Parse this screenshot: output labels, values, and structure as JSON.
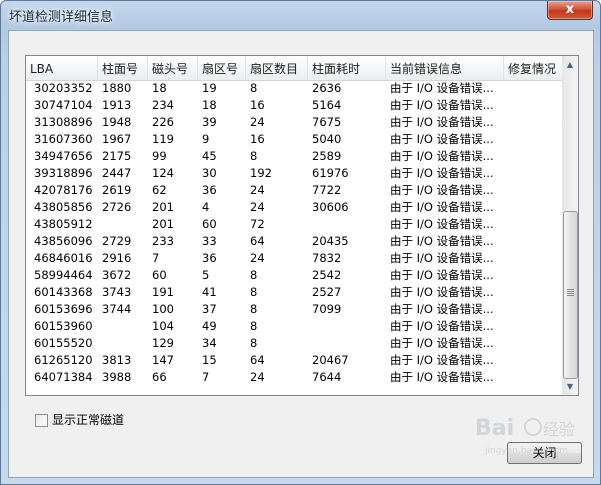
{
  "window": {
    "title": "坏道检测详细信息",
    "close_glyph": "x"
  },
  "table": {
    "columns": [
      "LBA",
      "柱面号",
      "磁头号",
      "扇区号",
      "扇区数目",
      "柱面耗时",
      "当前错误信息",
      "修复情况"
    ],
    "rows": [
      [
        "30203352",
        "1880",
        "18",
        "19",
        "8",
        "2636",
        "由于 I/O 设备错误...",
        ""
      ],
      [
        "30747104",
        "1913",
        "234",
        "18",
        "16",
        "5164",
        "由于 I/O 设备错误...",
        ""
      ],
      [
        "31308896",
        "1948",
        "226",
        "39",
        "24",
        "7675",
        "由于 I/O 设备错误...",
        ""
      ],
      [
        "31607360",
        "1967",
        "119",
        "9",
        "16",
        "5040",
        "由于 I/O 设备错误...",
        ""
      ],
      [
        "34947656",
        "2175",
        "99",
        "45",
        "8",
        "2589",
        "由于 I/O 设备错误...",
        ""
      ],
      [
        "39318896",
        "2447",
        "124",
        "30",
        "192",
        "61976",
        "由于 I/O 设备错误...",
        ""
      ],
      [
        "42078176",
        "2619",
        "62",
        "36",
        "24",
        "7722",
        "由于 I/O 设备错误...",
        ""
      ],
      [
        "43805856",
        "2726",
        "201",
        "4",
        "24",
        "30606",
        "由于 I/O 设备错误...",
        ""
      ],
      [
        "43805912",
        "",
        "201",
        "60",
        "72",
        "",
        "由于 I/O 设备错误...",
        ""
      ],
      [
        "43856096",
        "2729",
        "233",
        "33",
        "64",
        "20435",
        "由于 I/O 设备错误...",
        ""
      ],
      [
        "46846016",
        "2916",
        "7",
        "36",
        "24",
        "7832",
        "由于 I/O 设备错误...",
        ""
      ],
      [
        "58994464",
        "3672",
        "60",
        "5",
        "8",
        "2542",
        "由于 I/O 设备错误...",
        ""
      ],
      [
        "60143368",
        "3743",
        "191",
        "41",
        "8",
        "2527",
        "由于 I/O 设备错误...",
        ""
      ],
      [
        "60153696",
        "3744",
        "100",
        "37",
        "8",
        "7099",
        "由于 I/O 设备错误...",
        ""
      ],
      [
        "60153960",
        "",
        "104",
        "49",
        "8",
        "",
        "由于 I/O 设备错误...",
        ""
      ],
      [
        "60155520",
        "",
        "129",
        "34",
        "8",
        "",
        "由于 I/O 设备错误...",
        ""
      ],
      [
        "61265120",
        "3813",
        "147",
        "15",
        "64",
        "20467",
        "由于 I/O 设备错误...",
        ""
      ],
      [
        "64071384",
        "3988",
        "66",
        "7",
        "24",
        "7644",
        "由于 I/O 设备错误...",
        ""
      ]
    ]
  },
  "scrollbar": {
    "up_glyph": "▲",
    "down_glyph": "▼"
  },
  "options": {
    "show_normal_tracks_label": "显示正常磁道",
    "show_normal_tracks_checked": false
  },
  "buttons": {
    "close_label": "关闭"
  },
  "watermark": {
    "text": "Bai 经验",
    "subtext": "jingyan.baidu.com"
  }
}
